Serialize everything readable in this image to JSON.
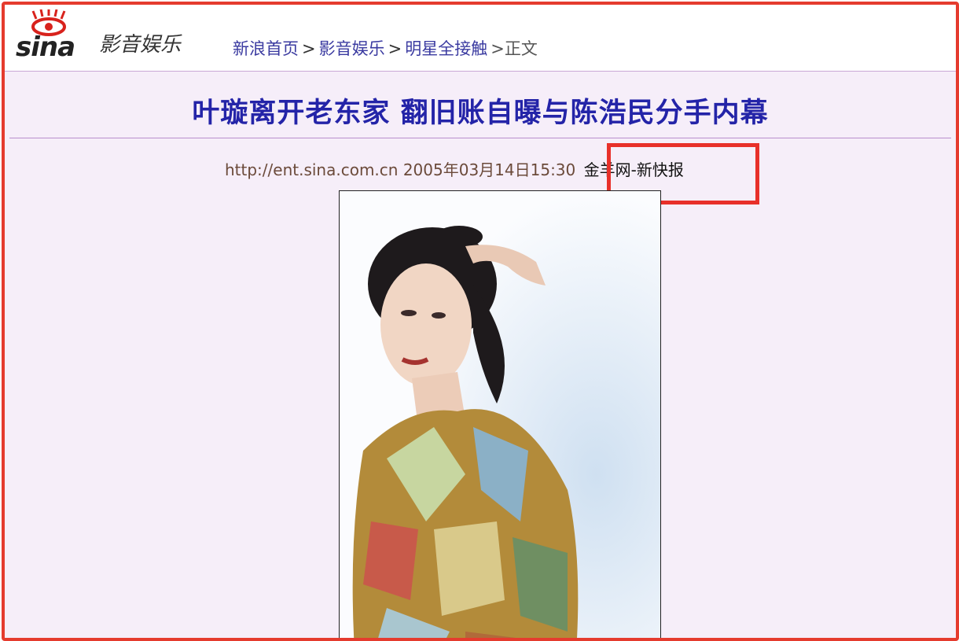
{
  "logo": {
    "brand": "sina",
    "icon": "sina-eye-icon"
  },
  "section": {
    "title": "影音娱乐"
  },
  "breadcrumb": {
    "items": [
      "新浪首页",
      "影音娱乐",
      "明星全接触"
    ],
    "separator": ">",
    "current": ">正文"
  },
  "article": {
    "headline": "叶璇离开老东家 翻旧账自曝与陈浩民分手内幕",
    "meta_prefix": "http://ent.sina.com.cn 2005年03月14日15:30",
    "source": "金羊网-新快报"
  },
  "colors": {
    "frame_border": "#e53b2e",
    "page_background": "#f6eef9",
    "headline": "#2424a8",
    "link": "#3a3aa0",
    "highlight_box": "#e8302a"
  },
  "photo": {
    "icon": "article-photo"
  }
}
